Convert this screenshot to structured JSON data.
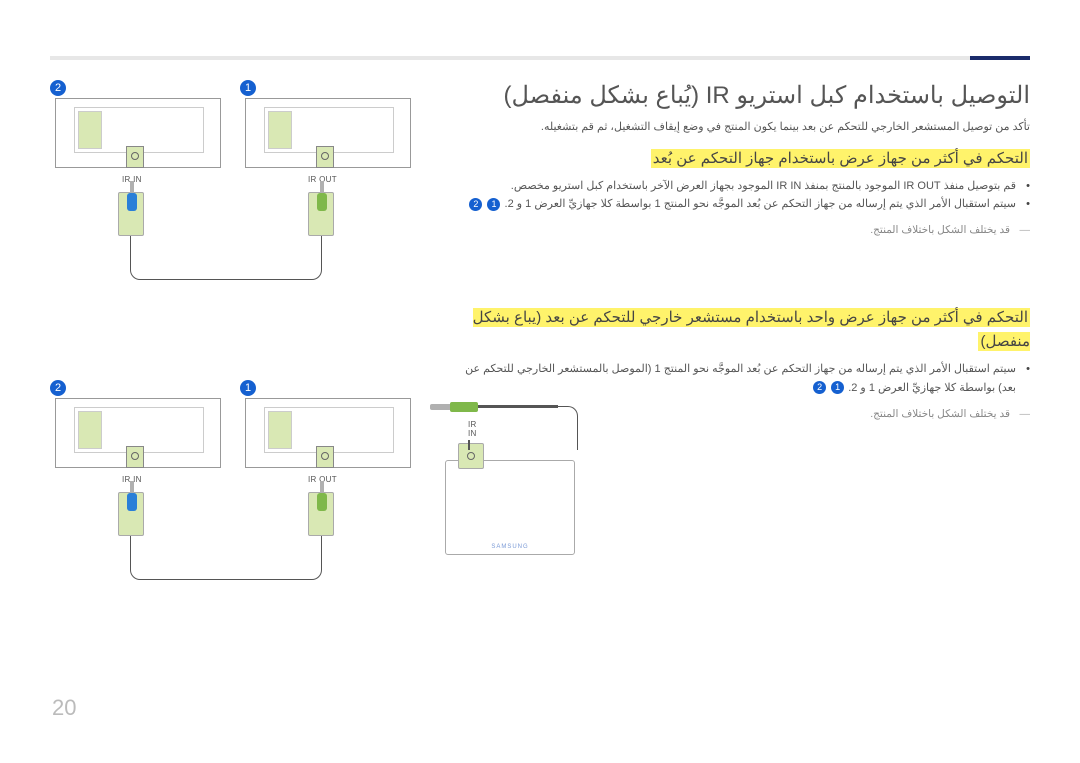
{
  "page_number": "20",
  "title": "التوصيل باستخدام كبل استريو IR (يُباع بشكل منفصل)",
  "intro": "تأكد من توصيل المستشعر الخارجي للتحكم عن بعد بينما يكون المنتج في وضع إيقاف التشغيل، ثم قم بتشغيله.",
  "section1": {
    "heading": "التحكم في أكثر من جهاز عرض باستخدام جهاز التحكم عن بُعد",
    "bullets": [
      "قم بتوصيل منفذ IR OUT الموجود بالمنتج بمنفذ IR IN الموجود بجهاز العرض الآخر باستخدام كبل استريو مخصص.",
      "سيتم استقبال الأمر الذي يتم إرساله من جهاز التحكم عن بُعد الموجَّه نحو المنتج 1 بواسطة كلا جهازيِّ العرض 1 و 2."
    ],
    "note": "قد يختلف الشكل باختلاف المنتج."
  },
  "section2": {
    "heading": "التحكم في أكثر من جهاز عرض واحد باستخدام مستشعر خارجي للتحكم عن بعد (يباع بشكل منفصل)",
    "bullets": [
      "سيتم استقبال الأمر الذي يتم إرساله من جهاز التحكم عن بُعد الموجَّه نحو المنتج 1 (الموصل بالمستشعر الخارجي للتحكم عن بعد) بواسطة كلا جهازيِّ العرض 1 و 2."
    ],
    "note": "قد يختلف الشكل باختلاف المنتج."
  },
  "labels": {
    "ir_in": "IR IN",
    "ir_out": "IR OUT",
    "one": "1",
    "two": "2",
    "brand": "SAMSUNG"
  }
}
